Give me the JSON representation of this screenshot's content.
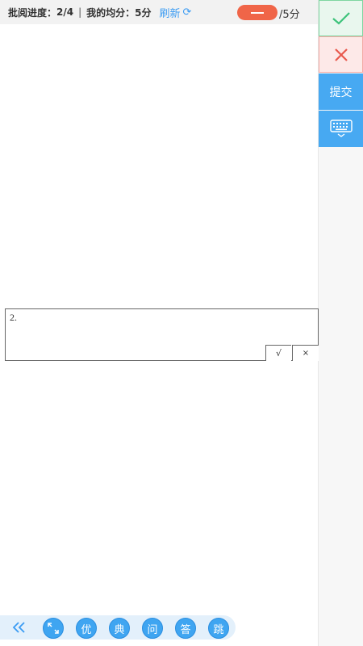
{
  "header": {
    "progress_label": "批阅进度：",
    "progress_value": "2/4",
    "separator": "|",
    "avg_label": "我的均分：",
    "avg_value": "5分",
    "refresh_label": "刷新",
    "score_total": "/5分"
  },
  "sidebar": {
    "submit_label": "提交"
  },
  "answer": {
    "number": "2.",
    "right_mark": "√",
    "wrong_mark": "×"
  },
  "toolbar": {
    "buttons": [
      "优",
      "典",
      "问",
      "答",
      "跳"
    ]
  },
  "colors": {
    "accent": "#47a9f2",
    "score_pill": "#f06548",
    "correct": "#3cc37a",
    "wrong": "#e8584c"
  }
}
